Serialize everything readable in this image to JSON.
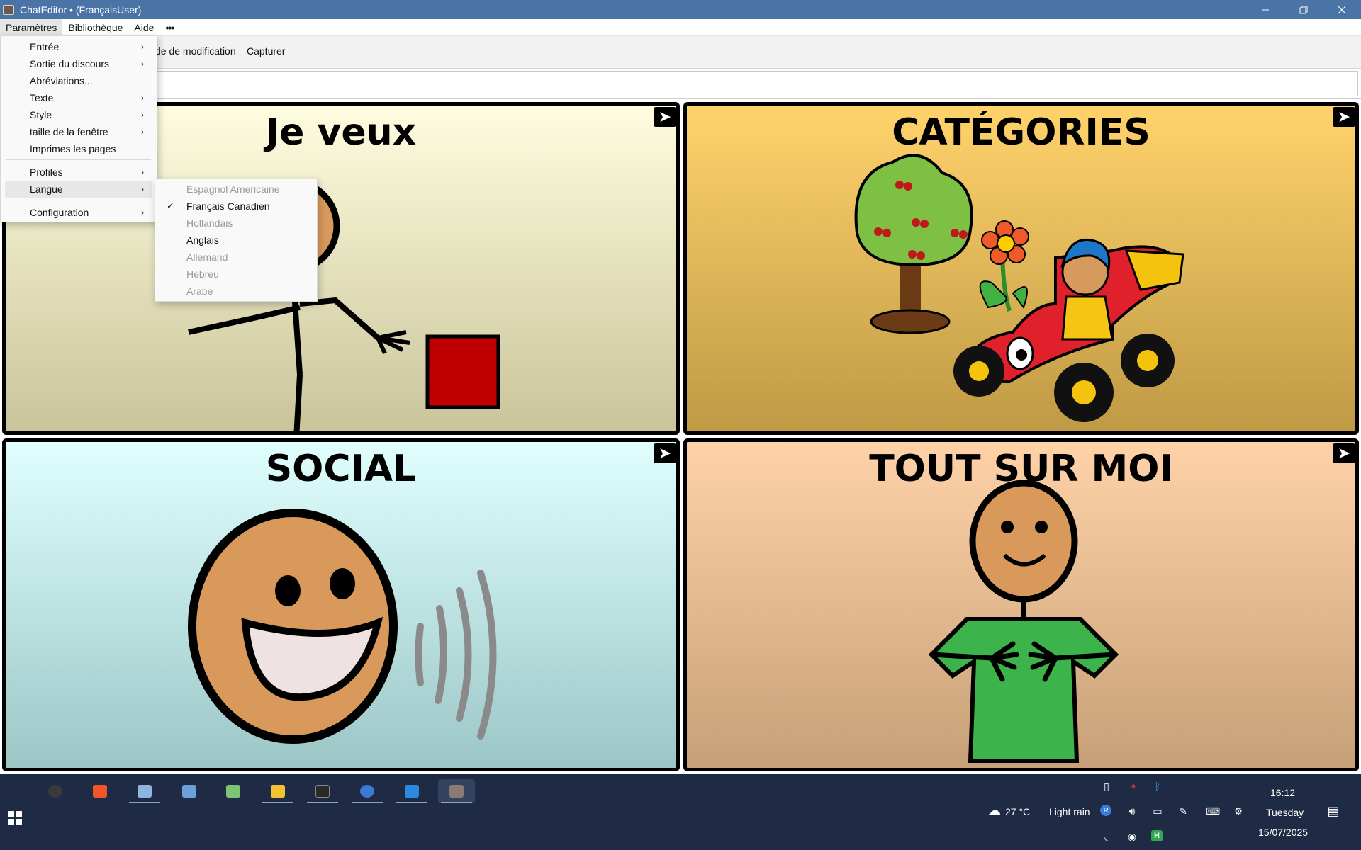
{
  "window": {
    "title": "ChatEditor • (FrançaisUser)"
  },
  "menubar": {
    "items": [
      "Paramètres",
      "Bibliothèque",
      "Aide",
      "•••"
    ]
  },
  "toolbar": {
    "mode_label": "de de modification",
    "capture_label": "Capturer"
  },
  "main_menu": {
    "items": [
      {
        "label": "Entrée",
        "submenu": true
      },
      {
        "label": "Sortie du discours",
        "submenu": true
      },
      {
        "label": "Abréviations...",
        "submenu": false
      },
      {
        "label": "Texte",
        "submenu": true
      },
      {
        "label": "Style",
        "submenu": true
      },
      {
        "label": "taille de la fenêtre",
        "submenu": true
      },
      {
        "label": "Imprimes les pages",
        "submenu": false
      },
      {
        "label": "Profiles",
        "submenu": true
      },
      {
        "label": "Langue",
        "submenu": true
      },
      {
        "label": "Configuration",
        "submenu": true
      }
    ]
  },
  "language_menu": {
    "items": [
      {
        "label": "Espagnol Americaine",
        "enabled": false,
        "checked": false
      },
      {
        "label": "Français Canadien",
        "enabled": true,
        "checked": true
      },
      {
        "label": "Hollandais",
        "enabled": false,
        "checked": false
      },
      {
        "label": "Anglais",
        "enabled": true,
        "checked": false
      },
      {
        "label": "Allemand",
        "enabled": false,
        "checked": false
      },
      {
        "label": "Hébreu",
        "enabled": false,
        "checked": false
      },
      {
        "label": "Arabe",
        "enabled": false,
        "checked": false
      }
    ],
    "check_glyph": "✓"
  },
  "grid": {
    "cells": [
      {
        "label": "Je veux",
        "icon": "want-reaching-figure"
      },
      {
        "label": "CATÉGORIES",
        "icon": "tree-flower-racecar"
      },
      {
        "label": "SOCIAL",
        "icon": "smiling-talking-face"
      },
      {
        "label": "TOUT SUR MOI",
        "icon": "person-hands-on-chest"
      }
    ],
    "arrow_glyph": "➤"
  },
  "taskbar": {
    "apps": [
      "obs",
      "brave",
      "remote-desktop",
      "photos",
      "notepad",
      "file-explorer",
      "terminal",
      "r-app",
      "vscode",
      "chateditor"
    ],
    "weather": {
      "temp": "27 °C",
      "condition": "Light rain"
    },
    "clock": {
      "time": "16:12",
      "day": "Tuesday",
      "date": "15/07/2025"
    }
  },
  "colors": {
    "titlebar": "#4a73a6",
    "taskbar": "#1f2b44",
    "cell_want": "#fffde0",
    "cell_categories": "#ffd26b",
    "cell_social": "#e0fffe",
    "cell_about_me": "#ffd2a8"
  }
}
